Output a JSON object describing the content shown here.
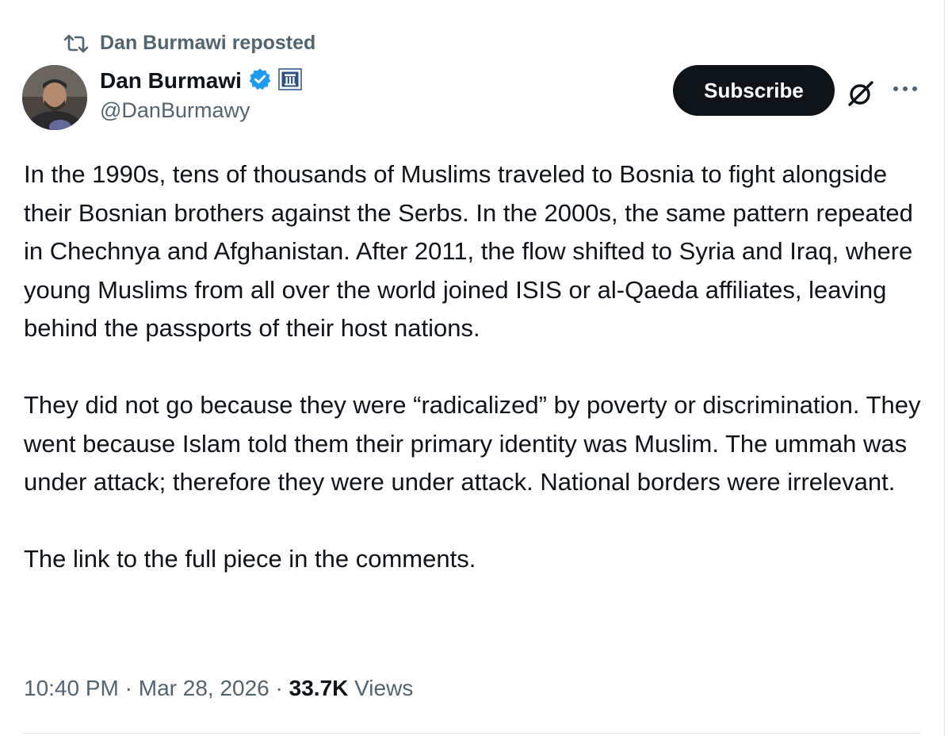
{
  "repost": {
    "label": "Dan Burmawi reposted",
    "icon": "repost-icon"
  },
  "author": {
    "display_name": "Dan Burmawi",
    "handle": "@DanBurmawy",
    "verified_icon": "verified-badge-icon",
    "affiliate_icon": "affiliate-badge-icon"
  },
  "actions": {
    "subscribe_label": "Subscribe",
    "grok_icon": "grok-icon",
    "more_icon": "more-options-icon"
  },
  "tweet": {
    "paragraphs": [
      "In the 1990s, tens of thousands of Muslims traveled to Bosnia to fight alongside their Bosnian brothers against the Serbs. In the 2000s, the same pattern repeated in Chechnya and Afghanistan. After 2011, the flow shifted to Syria and Iraq, where young Muslims from all over the world joined ISIS or al-Qaeda affiliates, leaving behind the passports of their host nations.",
      "They did not go because they were “radicalized” by poverty or discrimination. They went because Islam told them their primary identity was Muslim. The ummah was under attack; therefore they were under attack. National borders were irrelevant.",
      "The link to the full piece in the comments."
    ]
  },
  "meta": {
    "time": "10:40 PM",
    "separator": " · ",
    "date": "Mar 28, 2026",
    "views_count": "33.7K",
    "views_label": "Views"
  },
  "colors": {
    "text_primary": "#0f1419",
    "text_secondary": "#536471",
    "verified_blue": "#1d9bf0",
    "subscribe_bg": "#0f1419"
  }
}
